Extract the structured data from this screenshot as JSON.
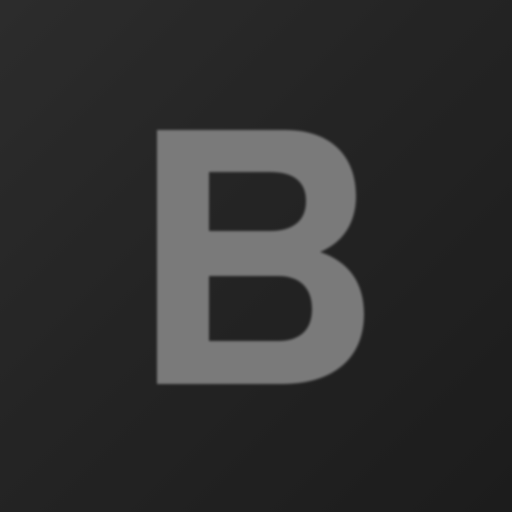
{
  "icon": {
    "letter": "B",
    "glyph_name": "letter-b-glyph",
    "letter_color": "#7a7a7a",
    "background_color_top_left": "#2c2c2c",
    "background_color_bottom_right": "#1c1c1c"
  }
}
